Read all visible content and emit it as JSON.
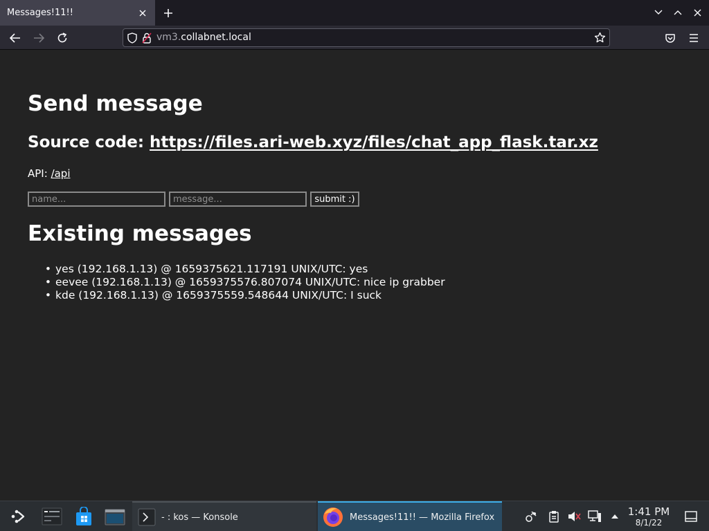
{
  "browser": {
    "tab": {
      "title": "Messages!11!!"
    },
    "url": {
      "domain_dim": "vm3.",
      "domain": "collabnet.local"
    }
  },
  "page": {
    "heading": "Send message",
    "source": {
      "label": "Source code: ",
      "link": "https://files.ari-web.xyz/files/chat_app_flask.tar.xz"
    },
    "api": {
      "label": "API: ",
      "link": "/api"
    },
    "form": {
      "name_placeholder": "name...",
      "message_placeholder": "message...",
      "submit_label": "submit :)"
    },
    "messages_heading": "Existing messages",
    "messages": [
      "yes (192.168.1.13) @ 1659375621.117191 UNIX/UTC: yes",
      "eevee (192.168.1.13) @ 1659375576.807074 UNIX/UTC: nice ip grabber",
      "kde (192.168.1.13) @ 1659375559.548644 UNIX/UTC: I suck"
    ]
  },
  "taskbar": {
    "tasks": [
      {
        "label": "- : kos — Konsole"
      },
      {
        "label": "Messages!11!! — Mozilla Firefox"
      }
    ],
    "clock": {
      "time": "1:41 PM",
      "date": "8/1/22"
    }
  },
  "colors": {
    "page_bg": "#232323",
    "tab_active": "#42414d",
    "taskbar_active": "#3daee9"
  }
}
